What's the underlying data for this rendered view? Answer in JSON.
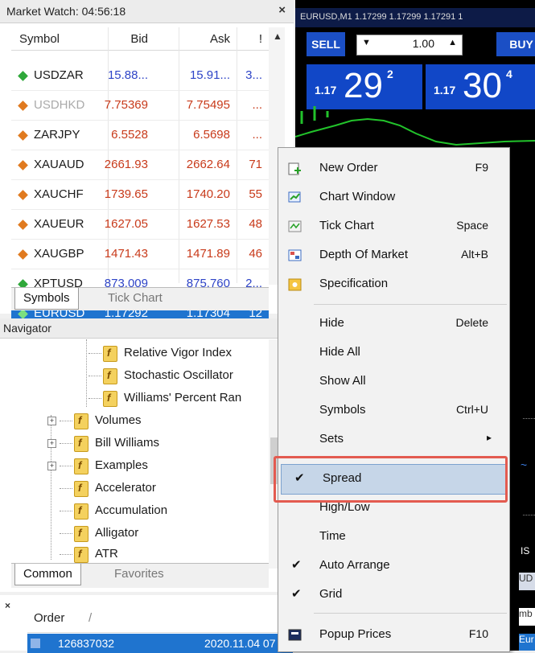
{
  "market_watch": {
    "title": "Market Watch: 04:56:18",
    "columns": {
      "symbol": "Symbol",
      "bid": "Bid",
      "ask": "Ask",
      "spread": "!"
    },
    "rows": [
      {
        "symbol": "USDZAR",
        "bid": "15.88...",
        "ask": "15.91...",
        "spread": "3...",
        "arrow": "up",
        "color": "#2e44c7"
      },
      {
        "symbol": "USDHKD",
        "bid": "7.75369",
        "ask": "7.75495",
        "spread": "...",
        "arrow": "down",
        "color": "#c83a1a"
      },
      {
        "symbol": "ZARJPY",
        "bid": "6.5528",
        "ask": "6.5698",
        "spread": "...",
        "arrow": "down",
        "color": "#c83a1a"
      },
      {
        "symbol": "XAUAUD",
        "bid": "2661.93",
        "ask": "2662.64",
        "spread": "71",
        "arrow": "down",
        "color": "#c83a1a"
      },
      {
        "symbol": "XAUCHF",
        "bid": "1739.65",
        "ask": "1740.20",
        "spread": "55",
        "arrow": "down",
        "color": "#c83a1a"
      },
      {
        "symbol": "XAUEUR",
        "bid": "1627.05",
        "ask": "1627.53",
        "spread": "48",
        "arrow": "down",
        "color": "#c83a1a"
      },
      {
        "symbol": "XAUGBP",
        "bid": "1471.43",
        "ask": "1471.89",
        "spread": "46",
        "arrow": "down",
        "color": "#c83a1a"
      },
      {
        "symbol": "XPTUSD",
        "bid": "873.009",
        "ask": "875.760",
        "spread": "2...",
        "arrow": "up",
        "color": "#2e44c7"
      },
      {
        "symbol": "EURUSD",
        "bid": "1.17292",
        "ask": "1.17304",
        "spread": "12",
        "arrow": "up",
        "color": "#ffffff",
        "selected": true
      }
    ],
    "tabs": [
      "Symbols",
      "Tick Chart"
    ]
  },
  "navigator": {
    "title": "Navigator",
    "items": [
      "Relative Vigor Index",
      "Stochastic Oscillator",
      "Williams' Percent Ran",
      "Volumes",
      "Bill Williams",
      "Examples",
      "Accelerator",
      "Accumulation",
      "Alligator",
      "ATR"
    ],
    "tabs": [
      "Common",
      "Favorites"
    ]
  },
  "orders": {
    "header": "Order",
    "row_id": "126837032",
    "row_time": "2020.11.04 07"
  },
  "chart": {
    "title": "EURUSD,M1  1.17299 1.17299 1.17291 1",
    "sell": "SELL",
    "buy": "BUY",
    "lot": "1.00",
    "sell_small": "1.17",
    "sell_big": "29",
    "sell_pip": "2",
    "buy_small": "1.17",
    "buy_big": "30",
    "buy_pip": "4",
    "edge_labels": [
      "IS",
      "UD",
      "mb",
      "Eur"
    ]
  },
  "context_menu": {
    "items": [
      {
        "label": "New Order",
        "shortcut": "F9",
        "icon": "new-order-icon"
      },
      {
        "label": "Chart Window",
        "shortcut": "",
        "icon": "chart-window-icon"
      },
      {
        "label": "Tick Chart",
        "shortcut": "Space",
        "icon": "tick-chart-icon"
      },
      {
        "label": "Depth Of Market",
        "shortcut": "Alt+B",
        "icon": "depth-of-market-icon"
      },
      {
        "label": "Specification",
        "shortcut": "",
        "icon": "specification-icon"
      },
      {
        "label": "Hide",
        "shortcut": "Delete"
      },
      {
        "label": "Hide All",
        "shortcut": ""
      },
      {
        "label": "Show All",
        "shortcut": ""
      },
      {
        "label": "Symbols",
        "shortcut": "Ctrl+U"
      },
      {
        "label": "Sets",
        "shortcut": ""
      },
      {
        "label": "Spread",
        "shortcut": "",
        "checked": true,
        "highlighted": true
      },
      {
        "label": "High/Low",
        "shortcut": ""
      },
      {
        "label": "Time",
        "shortcut": ""
      },
      {
        "label": "Auto Arrange",
        "shortcut": "",
        "checked": true
      },
      {
        "label": "Grid",
        "shortcut": "",
        "checked": true
      },
      {
        "label": "Popup Prices",
        "shortcut": "F10",
        "icon": "popup-prices-icon"
      }
    ]
  }
}
